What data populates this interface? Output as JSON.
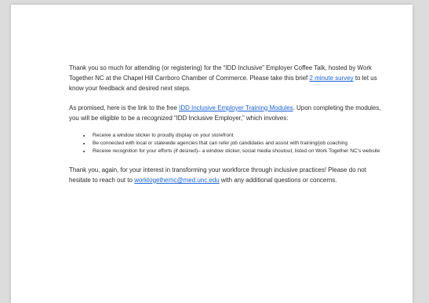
{
  "email": {
    "p1": {
      "before": "Thank you so much for attending (or registering) for the “IDD Inclusive” Employer Coffee Talk, hosted by Work Together NC at the Chapel Hill Carrboro Chamber of Commerce. Please take this brief ",
      "link": "2 minute survey",
      "after": " to let us know your feedback and desired next steps."
    },
    "p2": {
      "before": "As promised, here is the link to the free ",
      "link": "IDD Inclusive Employer Training Modules",
      "after": ". Upon completing the modules, you will be eligible to be a recognized “IDD Inclusive Employer,” which involves:"
    },
    "benefits": [
      "Receive a window sticker to proudly display on your storefront",
      "Be connected with local or statewide agencies that can refer job candidates and assist with training/job coaching",
      "Receive recognition for your efforts (if desired)– a window sticker, social media shoutout, listed on Work Together NC’s website"
    ],
    "p3": {
      "before": "Thank you, again, for your interest in transforming your workforce through inclusive practices! Please do not hesitate to reach out to ",
      "link": "worktogethernc@med.unc.edu",
      "after": " with any additional questions or concerns."
    }
  },
  "colors": {
    "page_bg": "#dcdcdc",
    "card_bg": "#ffffff",
    "link": "#1a63d8",
    "text": "#2b2b2b"
  }
}
